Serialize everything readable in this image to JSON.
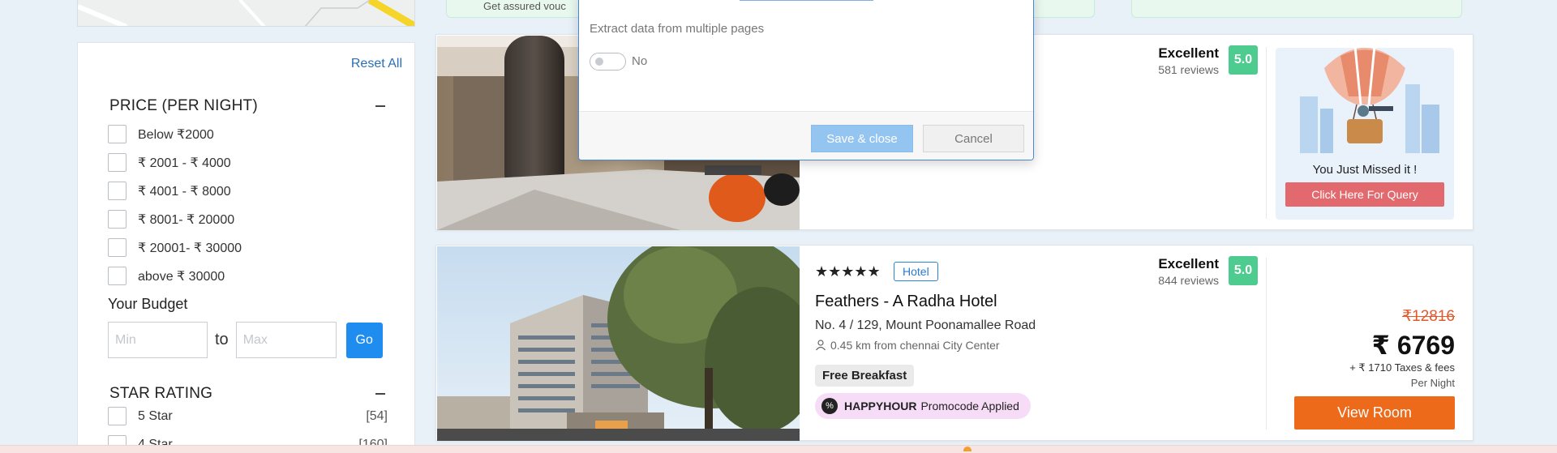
{
  "filters": {
    "reset_label": "Reset All",
    "price": {
      "title": "PRICE (PER NIGHT)",
      "options": [
        "Below ₹2000",
        "₹ 2001 - ₹ 4000",
        "₹ 4001 - ₹ 8000",
        "₹ 8001- ₹ 20000",
        "₹ 20001- ₹ 30000",
        "above ₹ 30000"
      ]
    },
    "budget": {
      "title": "Your Budget",
      "min_placeholder": "Min",
      "max_placeholder": "Max",
      "to_label": "to",
      "go_label": "Go"
    },
    "star_rating": {
      "title": "STAR RATING",
      "options": [
        {
          "label": "5 Star",
          "count": "[54]"
        },
        {
          "label": "4 Star",
          "count": "[160]"
        }
      ]
    }
  },
  "top_strip": {
    "text": "Get assured vouc"
  },
  "cards": [
    {
      "rating_word": "Excellent",
      "reviews": "581 reviews",
      "score": "5.0",
      "missed_text": "You Just Missed it !",
      "query_label": "Click Here For Query"
    },
    {
      "stars": "★★★★★",
      "type": "Hotel",
      "name": "Feathers - A Radha Hotel",
      "address": "No. 4 / 129, Mount Poonamallee Road",
      "distance": "0.45 km from chennai City Center",
      "rating_word": "Excellent",
      "reviews": "844 reviews",
      "score": "5.0",
      "breakfast": "Free Breakfast",
      "promo_code": "HAPPYHOUR",
      "promo_text": "Promocode Applied",
      "price_old": "₹12816",
      "price_new": "₹ 6769",
      "taxes": "+ ₹ 1710 Taxes & fees",
      "per_night": "Per Night",
      "view_label": "View Room"
    }
  ],
  "modal": {
    "label": "Extract data from multiple pages",
    "toggle_text": "No",
    "save_label": "Save & close",
    "cancel_label": "Cancel"
  },
  "colors": {
    "accent_blue": "#1f8cf0",
    "score_green": "#4ecb8f",
    "view_orange": "#ec6a19",
    "old_price": "#e2592c",
    "query_red": "#e26a6f"
  }
}
